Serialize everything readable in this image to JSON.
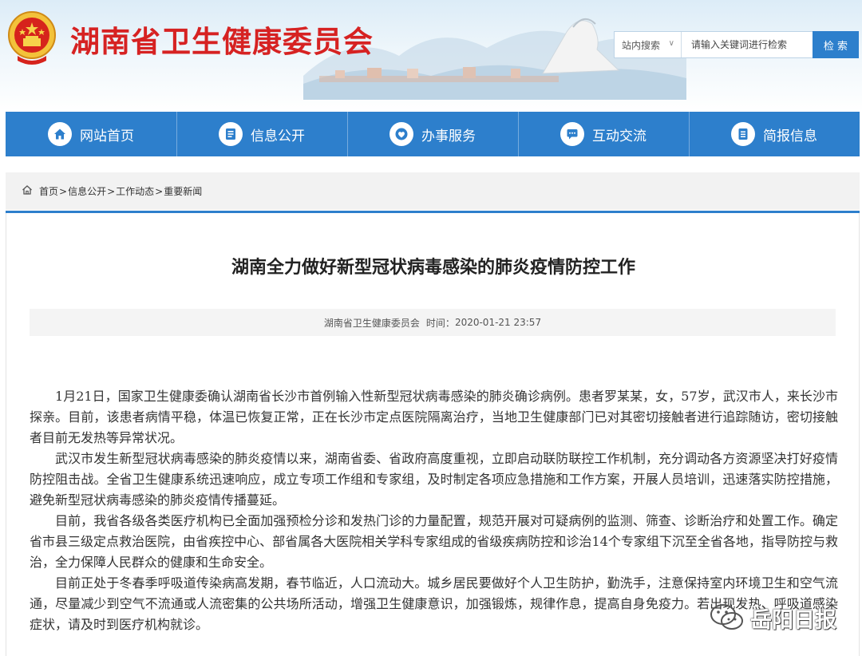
{
  "header": {
    "site_title": "湖南省卫生健康委员会",
    "search": {
      "scope_label": "站内搜索",
      "placeholder": "请输入关键词进行检索",
      "button_label": "检 索"
    }
  },
  "nav": {
    "items": [
      {
        "label": "网站首页",
        "icon": "home-icon"
      },
      {
        "label": "信息公开",
        "icon": "document-list-icon"
      },
      {
        "label": "办事服务",
        "icon": "heart-service-icon"
      },
      {
        "label": "互动交流",
        "icon": "chat-bubble-icon"
      },
      {
        "label": "简报信息",
        "icon": "briefing-icon"
      }
    ]
  },
  "breadcrumb": {
    "items": [
      "首页",
      "信息公开",
      "工作动态",
      "重要新闻"
    ],
    "separator": ">"
  },
  "article": {
    "title": "湖南全力做好新型冠状病毒感染的肺炎疫情防控工作",
    "source": "湖南省卫生健康委员会",
    "time_label": "时间：",
    "time_value": "2020-01-21 23:57",
    "paragraphs": [
      "1月21日，国家卫生健康委确认湖南省长沙市首例输入性新型冠状病毒感染的肺炎确诊病例。患者罗某某，女，57岁，武汉市人，来长沙市探亲。目前，该患者病情平稳，体温已恢复正常，正在长沙市定点医院隔离治疗，当地卫生健康部门已对其密切接触者进行追踪随访，密切接触者目前无发热等异常状况。",
      "武汉市发生新型冠状病毒感染的肺炎疫情以来，湖南省委、省政府高度重视，立即启动联防联控工作机制，充分调动各方资源坚决打好疫情防控阻击战。全省卫生健康系统迅速响应，成立专项工作组和专家组，及时制定各项应急措施和工作方案，开展人员培训，迅速落实防控措施，避免新型冠状病毒感染的肺炎疫情传播蔓延。",
      "目前，我省各级各类医疗机构已全面加强预检分诊和发热门诊的力量配置，规范开展对可疑病例的监测、筛查、诊断治疗和处置工作。确定省市县三级定点救治医院，由省疾控中心、部省属各大医院相关学科专家组成的省级疾病防控和诊治14个专家组下沉至全省各地，指导防控与救治，全力保障人民群众的健康和生命安全。",
      "目前正处于冬春季呼吸道传染病高发期，春节临近，人口流动大。城乡居民要做好个人卫生防护，勤洗手，注意保持室内环境卫生和空气流通，尽量减少到空气不流通或人流密集的公共场所活动，增强卫生健康意识，加强锻炼，规律作息，提高自身免疫力。若出现发热、呼吸道感染症状，请及时到医疗机构就诊。"
    ]
  },
  "watermark": {
    "text": "岳阳日报",
    "icon": "wechat-icon"
  },
  "colors": {
    "brand_red": "#d62222",
    "nav_blue": "#2d7fcc"
  }
}
